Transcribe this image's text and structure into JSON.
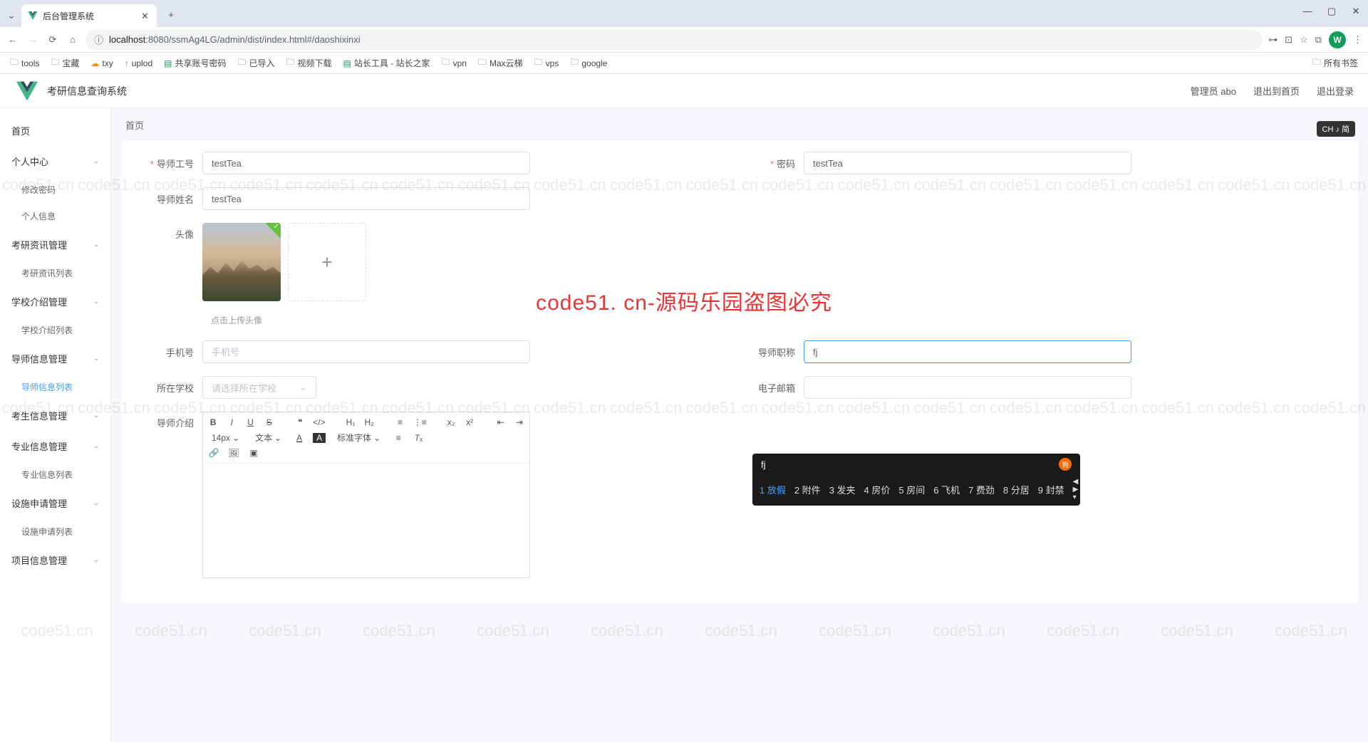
{
  "browser": {
    "tab_title": "后台管理系统",
    "url_domain": "localhost",
    "url_port": ":8080",
    "url_path": "/ssmAg4LG/admin/dist/index.html#/daoshixinxi",
    "avatar_letter": "W"
  },
  "bookmarks": [
    "tools",
    "宝藏",
    "txy",
    "uplod",
    "共享账号密码",
    "已导入",
    "视频下载",
    "站长工具 - 站长之家",
    "vpn",
    "Max云梯",
    "vps",
    "google"
  ],
  "bookmarks_right": "所有书签",
  "app": {
    "title": "考研信息查询系统",
    "user_label": "管理员 abo",
    "exit_home": "退出到首页",
    "logout": "退出登录"
  },
  "breadcrumb": "首页",
  "sidebar": {
    "items": [
      {
        "label": "首页",
        "children": []
      },
      {
        "label": "个人中心",
        "children": [
          "修改密码",
          "个人信息"
        ]
      },
      {
        "label": "考研资讯管理",
        "children": [
          "考研资讯列表"
        ]
      },
      {
        "label": "学校介绍管理",
        "children": [
          "学校介绍列表"
        ]
      },
      {
        "label": "导师信息管理",
        "children": [
          "导师信息列表"
        ],
        "active": 0
      },
      {
        "label": "考生信息管理",
        "children": []
      },
      {
        "label": "专业信息管理",
        "children": [
          "专业信息列表"
        ]
      },
      {
        "label": "设施申请管理",
        "children": [
          "设施申请列表"
        ]
      },
      {
        "label": "项目信息管理",
        "children": []
      }
    ]
  },
  "form": {
    "teacher_id_label": "导师工号",
    "teacher_id_value": "testTea",
    "password_label": "密码",
    "password_value": "testTea",
    "name_label": "导师姓名",
    "name_value": "testTea",
    "avatar_label": "头像",
    "upload_hint": "点击上传头像",
    "phone_label": "手机号",
    "phone_placeholder": "手机号",
    "title_label": "导师职称",
    "title_value": "fj",
    "school_label": "所在学校",
    "school_placeholder": "请选择所在学校",
    "email_label": "电子邮箱",
    "intro_label": "导师介绍"
  },
  "editor": {
    "font_size": "14px",
    "font_family": "文本",
    "std_font": "标准字体"
  },
  "ime": {
    "input": "fj",
    "candidates": [
      "1 放假",
      "2 附件",
      "3 发夹",
      "4 房价",
      "5 房间",
      "6 飞机",
      "7 费劲",
      "8 分居",
      "9 封禁"
    ],
    "badge": "CH ♪ 简"
  },
  "watermark_text": "code51.cn",
  "watermark_red": "code51. cn-源码乐园盗图必究"
}
